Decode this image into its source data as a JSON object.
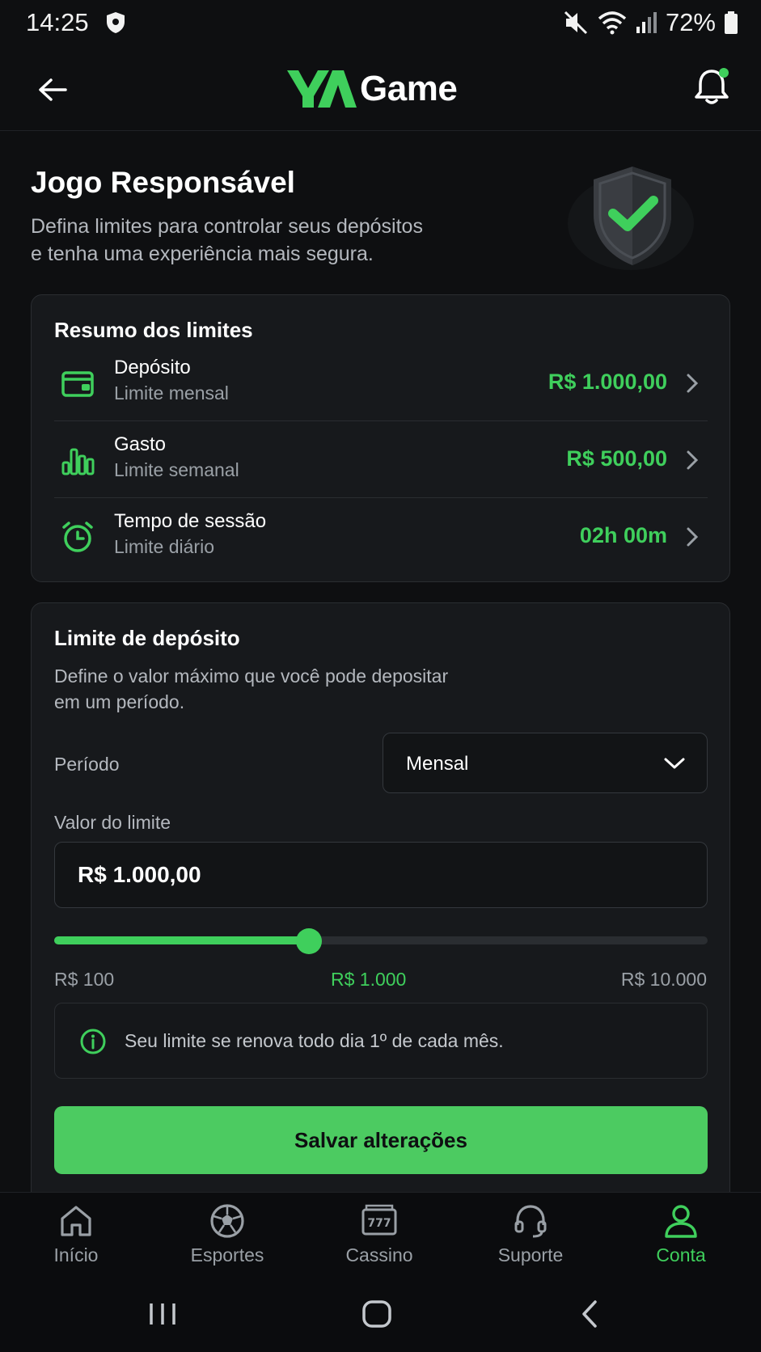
{
  "status_bar": {
    "time": "14:25",
    "battery": "72%",
    "icons": [
      "shield-icon",
      "mute-icon",
      "wifi-icon",
      "signal-icon",
      "battery-icon"
    ]
  },
  "header": {
    "logo_mark": "YA",
    "logo_text": "Game",
    "icons": [
      "back-arrow-icon",
      "bell-icon"
    ]
  },
  "hero": {
    "title": "Jogo Responsável",
    "subtitle_line1": "Defina limites para controlar seus depósitos",
    "subtitle_line2": "e tenha uma experiência mais segura."
  },
  "summary": {
    "title": "Resumo dos limites",
    "items": [
      {
        "name": "Depósito",
        "desc": "Limite mensal",
        "value": "R$ 1.000,00",
        "icon": "wallet-icon"
      },
      {
        "name": "Gasto",
        "desc": "Limite semanal",
        "value": "R$ 500,00",
        "icon": "bar-chart-icon"
      },
      {
        "name": "Tempo de sessão",
        "desc": "Limite diário",
        "value": "02h 00m",
        "icon": "alarm-clock-icon"
      }
    ]
  },
  "deposit": {
    "title": "Limite de depósito",
    "desc_line1": "Define o valor máximo que você pode depositar",
    "desc_line2": "em um período.",
    "period_label": "Período",
    "period_value": "Mensal",
    "value_label": "Valor do limite",
    "value_input": "R$ 1.000,00",
    "slider": {
      "min_label": "R$ 100",
      "current_label": "R$ 1.000",
      "max_label": "R$ 10.000",
      "fill_fraction": 0.39
    },
    "info_text": "Seu limite se renova todo dia 1º de cada mês.",
    "save_label": "Salvar alterações"
  },
  "bottom_nav": [
    {
      "label": "Início",
      "icon": "home-icon",
      "active": false
    },
    {
      "label": "Esportes",
      "icon": "soccer-ball-icon",
      "active": false
    },
    {
      "label": "Cassino",
      "icon": "slot-machine-icon",
      "active": false
    },
    {
      "label": "Suporte",
      "icon": "headset-icon",
      "active": false
    },
    {
      "label": "Conta",
      "icon": "user-icon",
      "active": true
    }
  ],
  "colors": {
    "accent": "#3fcf5c",
    "background": "#0e0f11",
    "card": "#17191c"
  }
}
